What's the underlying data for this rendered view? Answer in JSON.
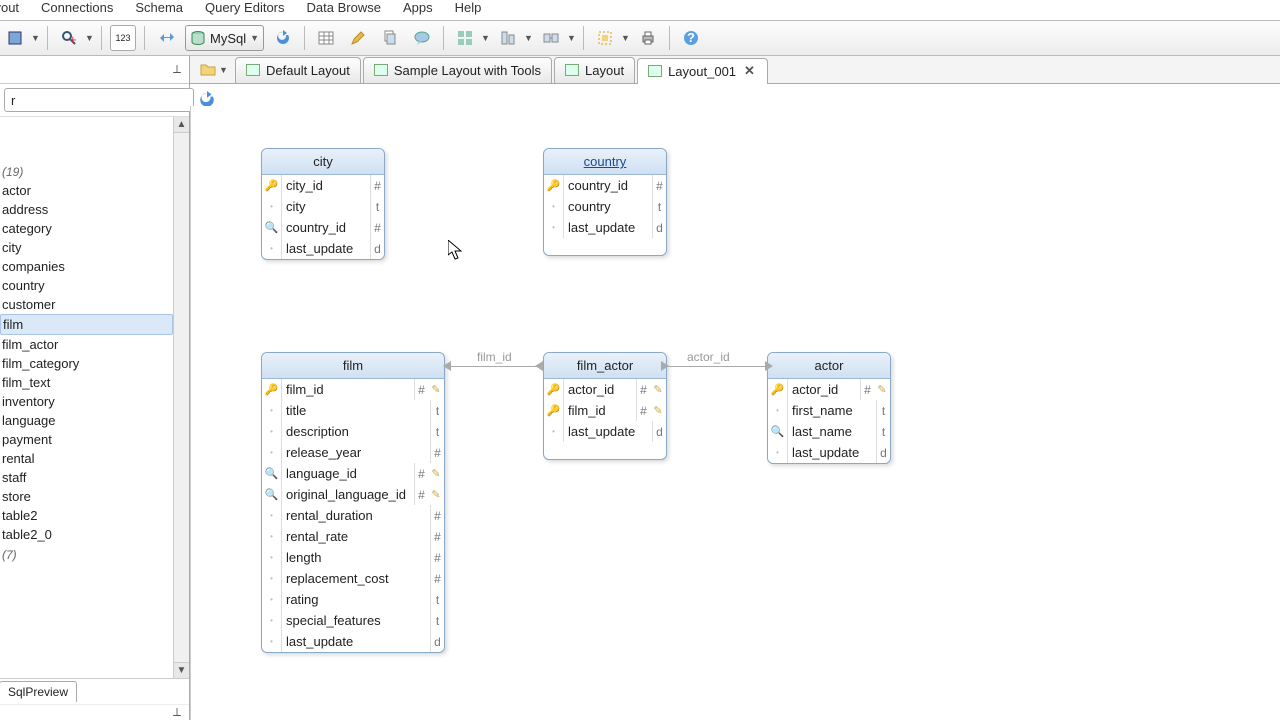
{
  "menu": {
    "items": [
      "Layout",
      "Connections",
      "Schema",
      "Query Editors",
      "Data Browse",
      "Apps",
      "Help"
    ]
  },
  "toolbar": {
    "db_engine": "MySql"
  },
  "tabs": [
    {
      "label": "Default Layout",
      "active": false,
      "closable": false
    },
    {
      "label": "Sample Layout with Tools",
      "active": false,
      "closable": false
    },
    {
      "label": "Layout",
      "active": false,
      "closable": false
    },
    {
      "label": "Layout_001",
      "active": true,
      "closable": true
    }
  ],
  "sidebar": {
    "filter": "r",
    "group_count": "(19)",
    "items": [
      {
        "label": "actor"
      },
      {
        "label": "address"
      },
      {
        "label": "category"
      },
      {
        "label": "city"
      },
      {
        "label": "companies"
      },
      {
        "label": "country"
      },
      {
        "label": "customer"
      },
      {
        "label": "film",
        "selected": true
      },
      {
        "label": "film_actor"
      },
      {
        "label": "film_category"
      },
      {
        "label": "film_text"
      },
      {
        "label": "inventory"
      },
      {
        "label": "language"
      },
      {
        "label": "payment"
      },
      {
        "label": "rental"
      },
      {
        "label": "staff"
      },
      {
        "label": "store"
      },
      {
        "label": "table2"
      },
      {
        "label": "table2_0"
      }
    ],
    "sub_group": "(7)",
    "footer_tab": "SqlPreview"
  },
  "diagram": {
    "relations": [
      {
        "label": "film_id"
      },
      {
        "label": "actor_id"
      }
    ],
    "entities": {
      "city": {
        "title": "city",
        "cols": [
          {
            "name": "city_id",
            "type": "#",
            "icon": "pk"
          },
          {
            "name": "city",
            "type": "t",
            "icon": "dot"
          },
          {
            "name": "country_id",
            "type": "#",
            "icon": "fk"
          },
          {
            "name": "last_update",
            "type": "d",
            "icon": "dot"
          }
        ]
      },
      "country": {
        "title": "country",
        "linked": true,
        "cols": [
          {
            "name": "country_id",
            "type": "#",
            "icon": "pk"
          },
          {
            "name": "country",
            "type": "t",
            "icon": "dot"
          },
          {
            "name": "last_update",
            "type": "d",
            "icon": "dot"
          }
        ]
      },
      "film": {
        "title": "film",
        "cols": [
          {
            "name": "film_id",
            "type": "#",
            "icon": "pk",
            "edge": "r"
          },
          {
            "name": "title",
            "type": "t",
            "icon": "dot"
          },
          {
            "name": "description",
            "type": "t",
            "icon": "dot"
          },
          {
            "name": "release_year",
            "type": "#",
            "icon": "dot"
          },
          {
            "name": "language_id",
            "type": "#",
            "icon": "fk",
            "edge": "r"
          },
          {
            "name": "original_language_id",
            "type": "#",
            "icon": "fk",
            "edge": "r"
          },
          {
            "name": "rental_duration",
            "type": "#",
            "icon": "dot"
          },
          {
            "name": "rental_rate",
            "type": "#",
            "icon": "dot"
          },
          {
            "name": "length",
            "type": "#",
            "icon": "dot"
          },
          {
            "name": "replacement_cost",
            "type": "#",
            "icon": "dot"
          },
          {
            "name": "rating",
            "type": "t",
            "icon": "dot"
          },
          {
            "name": "special_features",
            "type": "t",
            "icon": "dot"
          },
          {
            "name": "last_update",
            "type": "d",
            "icon": "dot"
          }
        ]
      },
      "film_actor": {
        "title": "film_actor",
        "cols": [
          {
            "name": "actor_id",
            "type": "#",
            "icon": "pk",
            "edge": "r"
          },
          {
            "name": "film_id",
            "type": "#",
            "icon": "pk",
            "edge": "r"
          },
          {
            "name": "last_update",
            "type": "d",
            "icon": "dot"
          }
        ]
      },
      "actor": {
        "title": "actor",
        "cols": [
          {
            "name": "actor_id",
            "type": "#",
            "icon": "pk",
            "edge": "r"
          },
          {
            "name": "first_name",
            "type": "t",
            "icon": "dot"
          },
          {
            "name": "last_name",
            "type": "t",
            "icon": "fk"
          },
          {
            "name": "last_update",
            "type": "d",
            "icon": "dot"
          }
        ]
      }
    }
  }
}
